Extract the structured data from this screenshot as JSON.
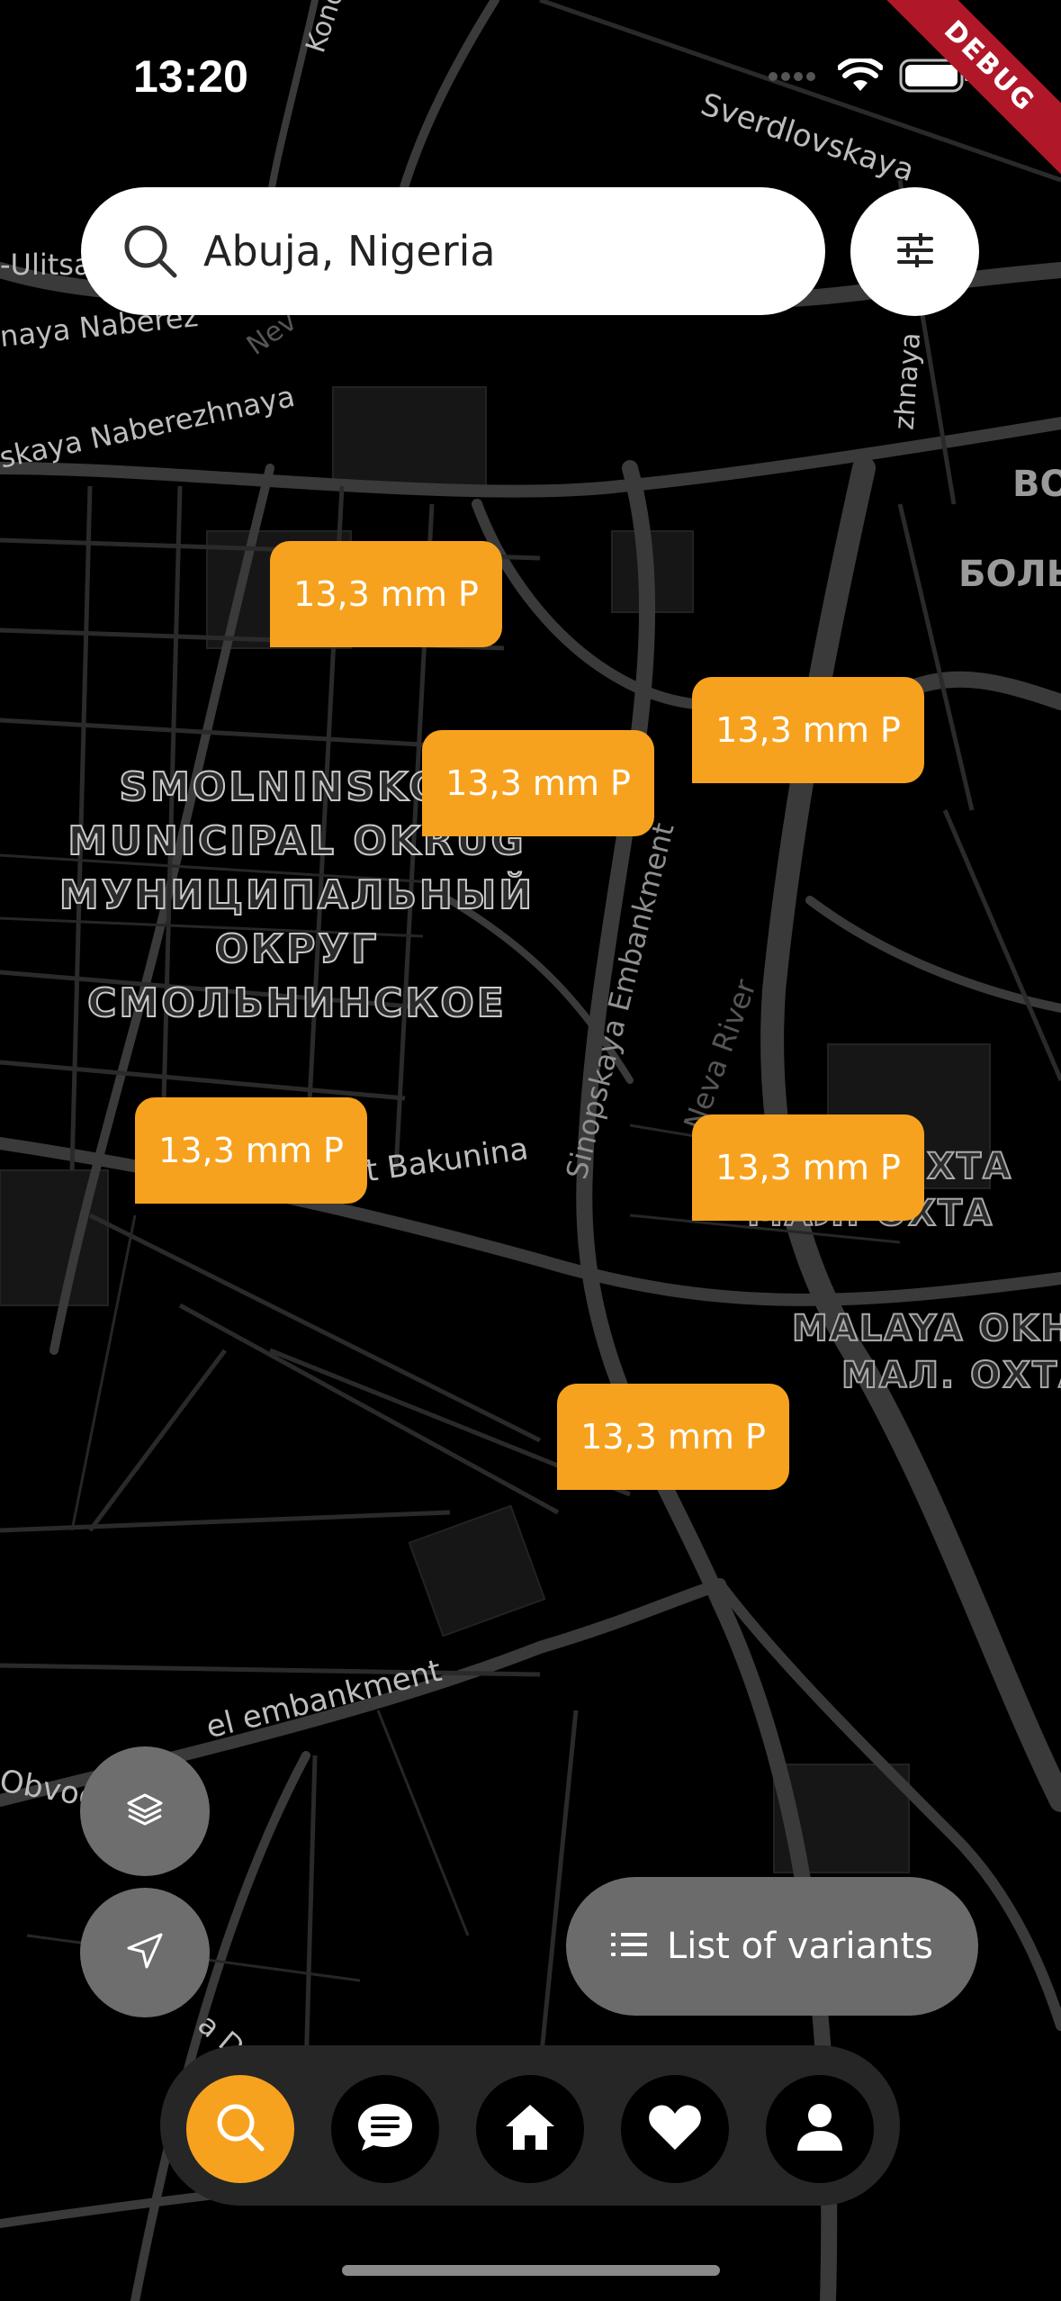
{
  "status_bar": {
    "time": "13:20"
  },
  "debug_banner": "DEBUG",
  "search": {
    "value": "Abuja, Nigeria"
  },
  "map": {
    "labels": {
      "kondratyevsky": "Kondra",
      "sverdlovskaya": "Sverdlovskaya",
      "ulitsa": "-Ulitsa",
      "naberezhnaya_1": "naya Naberez",
      "neva_frag": "Nev",
      "naberezhnaya_2": "skaya Naberezhnaya",
      "zhnaya": "zhnaya",
      "vo": "ВО",
      "bol": "БОЛЬ",
      "sinopskaya": "Sinopskaya Embankment",
      "neva_river": "Neva River",
      "bakunina": "pekt Bakunina",
      "ohta1": "ХТА",
      "ohta2": "МАЛ. ОХТА",
      "malaya_okhta": "MALAYA OKH",
      "mal_ohta": "МАЛ. ОХТА",
      "embankment": "el embankment",
      "obvodny": "Obvodr",
      "da": "a D"
    },
    "district_lines": [
      "SMOLNINSKOE",
      "MUNICIPAL OKRUG",
      "МУНИЦИПАЛЬНЫЙ",
      "ОКРУГ",
      "СМОЛЬНИНСКОЕ"
    ]
  },
  "markers": [
    {
      "label": "13,3 mm P"
    },
    {
      "label": "13,3 mm P"
    },
    {
      "label": "13,3 mm P"
    },
    {
      "label": "13,3 mm P"
    },
    {
      "label": "13,3 mm P"
    },
    {
      "label": "13,3 mm P"
    }
  ],
  "list_button": {
    "label": "List of variants"
  },
  "colors": {
    "accent": "#F7A21E",
    "nav_bg": "#262626",
    "fab_bg": "#6e6e6e"
  },
  "nav": [
    "search-icon",
    "chat-icon",
    "home-icon",
    "heart-icon",
    "profile-icon"
  ]
}
